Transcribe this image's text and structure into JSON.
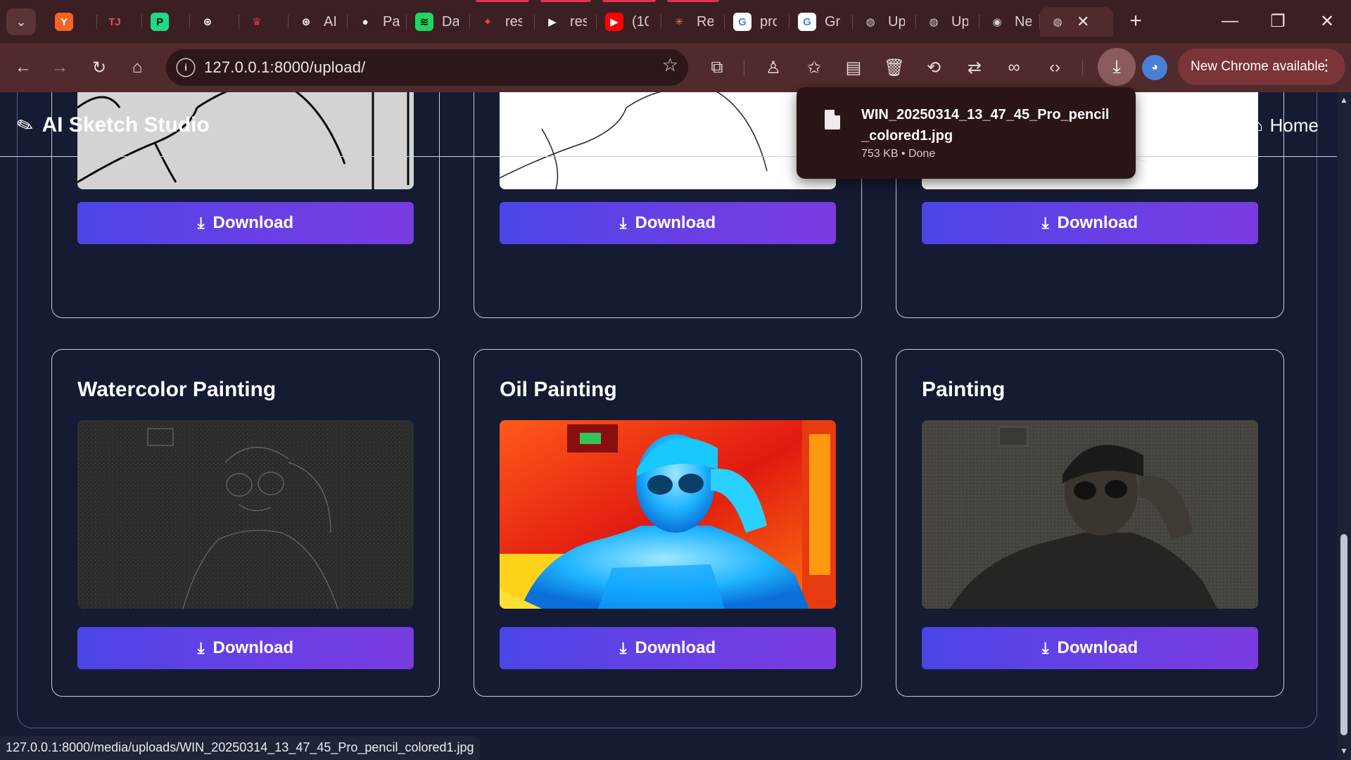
{
  "browser": {
    "tabs": [
      {
        "name": "tab-ycombinator",
        "favicon": "Y",
        "fav_bg": "#f26522",
        "fav_fg": "#ffffff",
        "label": ""
      },
      {
        "name": "tab-tj",
        "favicon": "TJ",
        "fav_bg": "#3c1f22",
        "fav_fg": "#e84a5f",
        "label": ""
      },
      {
        "name": "tab-pycharm",
        "favicon": "P",
        "fav_bg": "#21d789",
        "fav_fg": "#000000",
        "label": ""
      },
      {
        "name": "tab-openai-1",
        "favicon": "⊛",
        "fav_bg": "#3c1f22",
        "fav_fg": "#ffffff",
        "label": ""
      },
      {
        "name": "tab-crown",
        "favicon": "♛",
        "fav_bg": "#3c1f22",
        "fav_fg": "#e0334f",
        "label": ""
      },
      {
        "name": "tab-openai-2",
        "favicon": "⊛",
        "fav_bg": "#3c1f22",
        "fav_fg": "#ffffff",
        "label": "AI"
      },
      {
        "name": "tab-github",
        "favicon": "●",
        "fav_bg": "#3c1f22",
        "fav_fg": "#ffffff",
        "label": "Pa"
      },
      {
        "name": "tab-spotify",
        "favicon": "≋",
        "fav_bg": "#1ed760",
        "fav_fg": "#000000",
        "label": "Da"
      },
      {
        "name": "tab-figma",
        "favicon": "✦",
        "fav_bg": "#3c1f22",
        "fav_fg": "#f24e1e",
        "label": "res"
      },
      {
        "name": "tab-play",
        "favicon": "▶",
        "fav_bg": "#3c1f22",
        "fav_fg": "#ffffff",
        "label": "res"
      },
      {
        "name": "tab-youtube",
        "favicon": "▶",
        "fav_bg": "#ff0000",
        "fav_fg": "#ffffff",
        "label": "(10"
      },
      {
        "name": "tab-claude",
        "favicon": "✳",
        "fav_bg": "#3c1f22",
        "fav_fg": "#e07a52",
        "label": "Re"
      },
      {
        "name": "tab-google-1",
        "favicon": "G",
        "fav_bg": "#ffffff",
        "fav_fg": "#4285f4",
        "label": "pro"
      },
      {
        "name": "tab-google-2",
        "favicon": "G",
        "fav_bg": "#ffffff",
        "fav_fg": "#4285f4",
        "label": "Gr"
      },
      {
        "name": "tab-globe-1",
        "favicon": "◍",
        "fav_bg": "#3c1f22",
        "fav_fg": "#d9d0d0",
        "label": "Up"
      },
      {
        "name": "tab-globe-2",
        "favicon": "◍",
        "fav_bg": "#3c1f22",
        "fav_fg": "#d9d0d0",
        "label": "Up"
      },
      {
        "name": "tab-chrome",
        "favicon": "◉",
        "fav_bg": "#3c1f22",
        "fav_fg": "#d9d0d0",
        "label": "Ne"
      },
      {
        "name": "tab-active",
        "favicon": "◍",
        "fav_bg": "#512a2d",
        "fav_fg": "#d9d0d0",
        "label": ""
      }
    ],
    "new_tab": "+",
    "window_controls": {
      "minimize": "—",
      "restore": "❐",
      "close": "✕"
    },
    "url": "127.0.0.1:8000/upload/",
    "site_info_icon": "i",
    "update_chip": "New Chrome available",
    "status_url": "127.0.0.1:8000/media/uploads/WIN_20250314_13_47_45_Pro_pencil_colored1.jpg"
  },
  "download_bubble": {
    "filename": "WIN_20250314_13_47_45_Pro_pencil_colored1.jpg",
    "meta": "753 KB • Done"
  },
  "site": {
    "brand": "AI Sketch Studio",
    "nav_home": "Home"
  },
  "cards_top": [
    {
      "download_label": "Download"
    },
    {
      "download_label": "Download"
    },
    {
      "download_label": "Download"
    }
  ],
  "cards_bottom": [
    {
      "title": "Watercolor Painting",
      "download_label": "Download"
    },
    {
      "title": "Oil Painting",
      "download_label": "Download"
    },
    {
      "title": "Painting",
      "download_label": "Download"
    }
  ],
  "colors": {
    "page_bg": "#141b33",
    "button_gradient_start": "#4c45e6",
    "button_gradient_end": "#7a3ce0",
    "chrome_frame": "#3c1f22",
    "chrome_toolbar": "#512a2d"
  }
}
